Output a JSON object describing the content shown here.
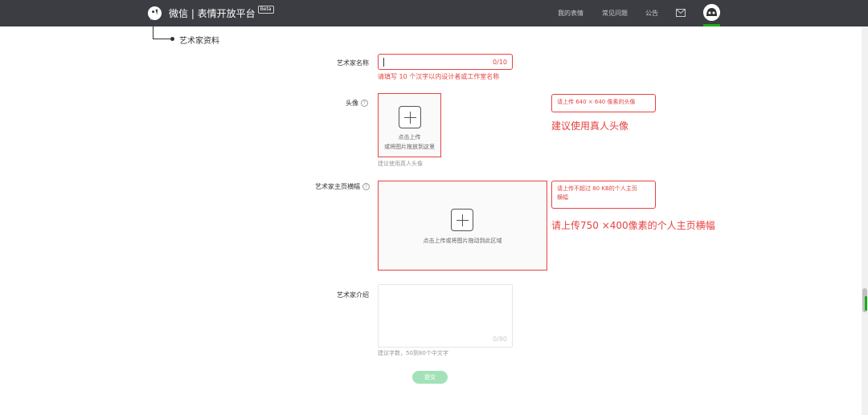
{
  "header": {
    "brand": "微信 | 表情开放平台",
    "beta": "Beta",
    "nav": [
      "我的表情",
      "常见问题",
      "公告"
    ]
  },
  "section": {
    "title": "艺术家资料"
  },
  "form": {
    "name": {
      "label": "艺术家名称",
      "counter": "0/10",
      "error": "请填写 10 个汉字以内设计者或工作室名称"
    },
    "avatar": {
      "label": "头像",
      "help": "?",
      "upload_line1": "点击上传",
      "upload_line2": "或将图片拖放到这里",
      "hint": "建议使用真人头像",
      "tip": "请上传 640 × 640 像素的头像",
      "annotation": "建议使用真人头像"
    },
    "banner": {
      "label": "艺术家主页横幅",
      "help": "?",
      "upload_text": "点击上传或将图片拖动到此区域",
      "tip_line1": "请上传不超过 80 KB的个人主页",
      "tip_line2": "横幅",
      "annotation": "请上传750 ×400像素的个人主页横幅"
    },
    "intro": {
      "label": "艺术家介绍",
      "counter": "0/80",
      "hint": "建议字数，50到80个中文字"
    },
    "submit_label": "提交"
  },
  "colors": {
    "header_bg": "#3b3d42",
    "error": "#e64340",
    "accent_green": "#1aad19",
    "submit_disabled": "#a3e2b8"
  }
}
